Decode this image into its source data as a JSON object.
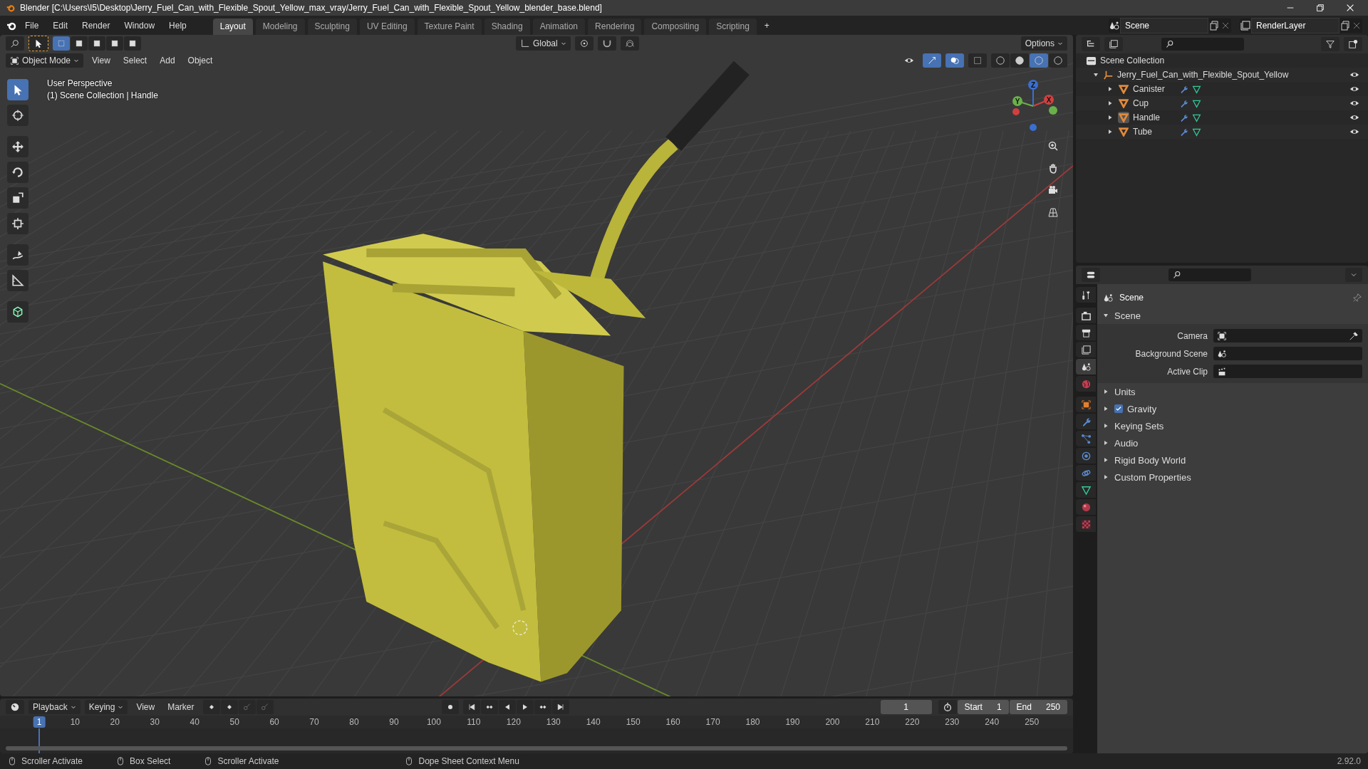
{
  "title_bar": {
    "title": "Blender [C:\\Users\\I5\\Desktop\\Jerry_Fuel_Can_with_Flexible_Spout_Yellow_max_vray/Jerry_Fuel_Can_with_Flexible_Spout_Yellow_blender_base.blend]"
  },
  "menu": [
    "File",
    "Edit",
    "Render",
    "Window",
    "Help"
  ],
  "workspaces": [
    {
      "label": "Layout",
      "selected": true
    },
    {
      "label": "Modeling",
      "selected": false
    },
    {
      "label": "Sculpting",
      "selected": false
    },
    {
      "label": "UV Editing",
      "selected": false
    },
    {
      "label": "Texture Paint",
      "selected": false
    },
    {
      "label": "Shading",
      "selected": false
    },
    {
      "label": "Animation",
      "selected": false
    },
    {
      "label": "Rendering",
      "selected": false
    },
    {
      "label": "Compositing",
      "selected": false
    },
    {
      "label": "Scripting",
      "selected": false
    }
  ],
  "add_workspace": "+",
  "scene_selector": {
    "value": "Scene"
  },
  "view_layer_selector": {
    "value": "RenderLayer"
  },
  "viewport": {
    "orientation": "Global",
    "options": "Options",
    "mode": "Object Mode",
    "menus": [
      "View",
      "Select",
      "Add",
      "Object"
    ],
    "overlay_text": [
      "User Perspective",
      "(1) Scene Collection | Handle"
    ],
    "gizmo_labels": [
      "Z",
      "Y",
      "X"
    ],
    "tools": [
      {
        "kind": "select",
        "selected": true
      },
      {
        "kind": "cursor",
        "selected": false
      },
      {
        "kind": "move",
        "selected": false
      },
      {
        "kind": "rotate",
        "selected": false
      },
      {
        "kind": "scale",
        "selected": false
      },
      {
        "kind": "transform",
        "selected": false
      },
      {
        "kind": "annotate",
        "selected": false
      },
      {
        "kind": "measure",
        "selected": false
      },
      {
        "kind": "add_cube",
        "selected": false
      }
    ]
  },
  "outliner": {
    "root": "Scene Collection",
    "collection": {
      "name": "Jerry_Fuel_Can_with_Flexible_Spout_Yellow",
      "expanded": true,
      "children": [
        {
          "name": "Canister",
          "selected": false
        },
        {
          "name": "Cup",
          "selected": false
        },
        {
          "name": "Handle",
          "selected": true
        },
        {
          "name": "Tube",
          "selected": false
        }
      ]
    }
  },
  "properties": {
    "context": "Scene",
    "tabs": [
      {
        "kind": "tool",
        "selected": false
      },
      {
        "kind": "render",
        "selected": false
      },
      {
        "kind": "output",
        "selected": false
      },
      {
        "kind": "view_layer",
        "selected": false
      },
      {
        "kind": "scene",
        "selected": true
      },
      {
        "kind": "world",
        "selected": false
      },
      {
        "kind": "object",
        "selected": false
      },
      {
        "kind": "modifier",
        "selected": false
      },
      {
        "kind": "particles",
        "selected": false
      },
      {
        "kind": "physics",
        "selected": false
      },
      {
        "kind": "constraints",
        "selected": false
      },
      {
        "kind": "data",
        "selected": false
      },
      {
        "kind": "material",
        "selected": false
      },
      {
        "kind": "texture",
        "selected": false
      }
    ],
    "panel": {
      "title": "Scene",
      "expanded": true,
      "fields": [
        {
          "label": "Camera",
          "kind": "camera"
        },
        {
          "label": "Background Scene",
          "kind": "scene"
        },
        {
          "label": "Active Clip",
          "kind": "clip"
        }
      ]
    },
    "sections": [
      {
        "label": "Units",
        "kind": "plain"
      },
      {
        "label": "Gravity",
        "kind": "checkbox",
        "checked": true
      },
      {
        "label": "Keying Sets",
        "kind": "plain"
      },
      {
        "label": "Audio",
        "kind": "plain"
      },
      {
        "label": "Rigid Body World",
        "kind": "plain"
      },
      {
        "label": "Custom Properties",
        "kind": "plain"
      }
    ]
  },
  "timeline": {
    "menus": [
      "Playback",
      "Keying",
      "View",
      "Marker"
    ],
    "current_frame": "1",
    "start_label": "Start",
    "start": "1",
    "end_label": "End",
    "end": "250",
    "playhead": "1",
    "ticks": [
      "10",
      "20",
      "30",
      "40",
      "50",
      "60",
      "70",
      "80",
      "90",
      "100",
      "110",
      "120",
      "130",
      "140",
      "150",
      "160",
      "170",
      "180",
      "190",
      "200",
      "210",
      "220",
      "230",
      "240",
      "250"
    ]
  },
  "status_bar": {
    "hints": [
      "Scroller Activate",
      "Box Select",
      "Scroller Activate",
      "Dope Sheet Context Menu"
    ],
    "version": "2.92.0"
  }
}
